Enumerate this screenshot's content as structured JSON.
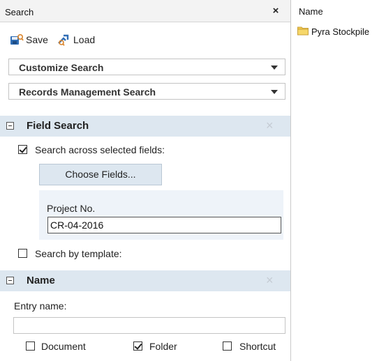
{
  "search_pane": {
    "title": "Search",
    "close_glyph": "×",
    "toolbar": {
      "save_label": "Save",
      "load_label": "Load",
      "save_icon": "save-search-icon",
      "load_icon": "load-search-icon"
    },
    "dropdowns": {
      "customize": "Customize Search",
      "records": "Records Management Search"
    },
    "field_search": {
      "title": "Field Search",
      "close_glyph": "×",
      "across_fields": {
        "label": "Search across selected fields:",
        "checked": true
      },
      "choose_fields_label": "Choose Fields...",
      "project_no": {
        "label": "Project No.",
        "value": "CR-04-2016"
      },
      "by_template": {
        "label": "Search by template:",
        "checked": false
      }
    },
    "name_section": {
      "title": "Name",
      "close_glyph": "×",
      "entry_name_label": "Entry name:",
      "entry_name_value": "",
      "types": {
        "document": {
          "label": "Document",
          "checked": false
        },
        "folder": {
          "label": "Folder",
          "checked": true
        },
        "shortcut": {
          "label": "Shortcut",
          "checked": false
        }
      }
    }
  },
  "results": {
    "column_header": "Name",
    "items": [
      {
        "name": "Pyra Stockpile",
        "icon": "folder-icon"
      }
    ]
  },
  "colors": {
    "section_header_bg": "#dde7f0",
    "folder_yellow": "#f2c94c",
    "save_blue": "#2f6db5",
    "load_blue": "#2f6db5"
  }
}
